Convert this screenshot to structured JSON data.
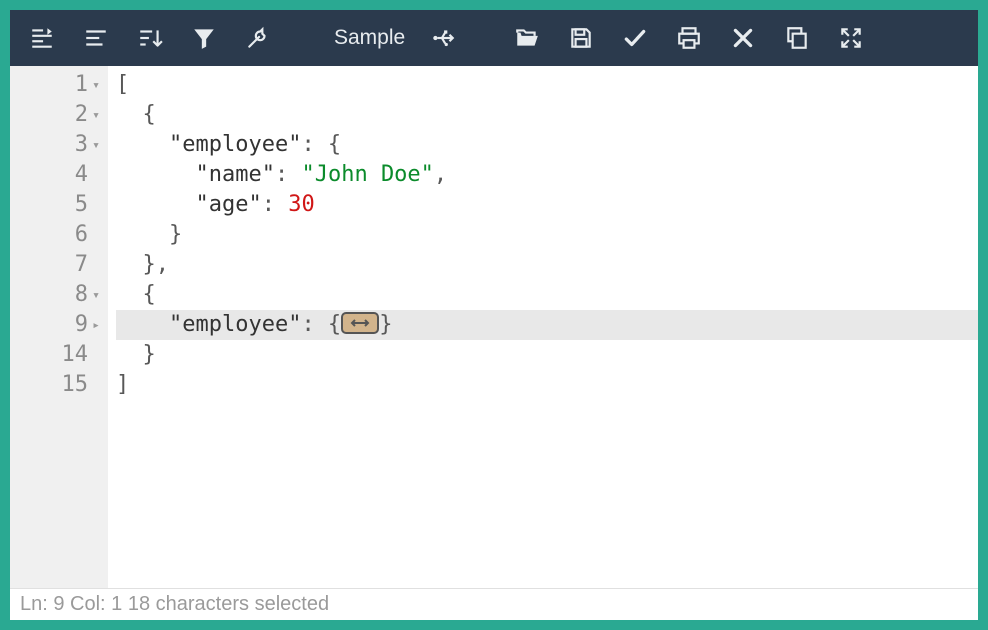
{
  "toolbar": {
    "sample_label": "Sample",
    "icons": {
      "indent_left": "indent-right-icon",
      "align_left": "align-left-icon",
      "sort": "sort-icon",
      "filter": "filter-icon",
      "wrench": "wrench-icon",
      "usb": "usb-icon",
      "open": "folder-open-icon",
      "save": "save-icon",
      "check": "check-icon",
      "print": "print-icon",
      "close": "close-icon",
      "copy": "copy-icon",
      "expand": "expand-icon"
    }
  },
  "editor": {
    "lines": [
      {
        "num": "1",
        "fold": "▾",
        "t": [
          {
            "c": "p",
            "v": "["
          }
        ]
      },
      {
        "num": "2",
        "fold": "▾",
        "t": [
          {
            "c": "p",
            "v": "  {"
          }
        ]
      },
      {
        "num": "3",
        "fold": "▾",
        "t": [
          {
            "c": "p",
            "v": "    "
          },
          {
            "c": "key",
            "v": "\"employee\""
          },
          {
            "c": "p",
            "v": ": {"
          }
        ]
      },
      {
        "num": "4",
        "fold": "",
        "t": [
          {
            "c": "p",
            "v": "      "
          },
          {
            "c": "key",
            "v": "\"name\""
          },
          {
            "c": "p",
            "v": ": "
          },
          {
            "c": "str",
            "v": "\"John Doe\""
          },
          {
            "c": "p",
            "v": ","
          }
        ]
      },
      {
        "num": "5",
        "fold": "",
        "t": [
          {
            "c": "p",
            "v": "      "
          },
          {
            "c": "key",
            "v": "\"age\""
          },
          {
            "c": "p",
            "v": ": "
          },
          {
            "c": "num",
            "v": "30"
          }
        ]
      },
      {
        "num": "6",
        "fold": "",
        "t": [
          {
            "c": "p",
            "v": "    }"
          }
        ]
      },
      {
        "num": "7",
        "fold": "",
        "t": [
          {
            "c": "p",
            "v": "  },"
          }
        ]
      },
      {
        "num": "8",
        "fold": "▾",
        "t": [
          {
            "c": "p",
            "v": "  {"
          }
        ]
      },
      {
        "num": "9",
        "fold": "▸",
        "hl": true,
        "folded": true,
        "t": [
          {
            "c": "p",
            "v": "    "
          },
          {
            "c": "key",
            "v": "\"employee\""
          },
          {
            "c": "p",
            "v": ": {"
          }
        ],
        "trail": "}"
      },
      {
        "num": "14",
        "fold": "",
        "t": [
          {
            "c": "p",
            "v": "  }"
          }
        ]
      },
      {
        "num": "15",
        "fold": "",
        "t": [
          {
            "c": "p",
            "v": "]"
          }
        ]
      }
    ]
  },
  "status": {
    "text": "Ln: 9    Col: 1    18 characters selected"
  }
}
